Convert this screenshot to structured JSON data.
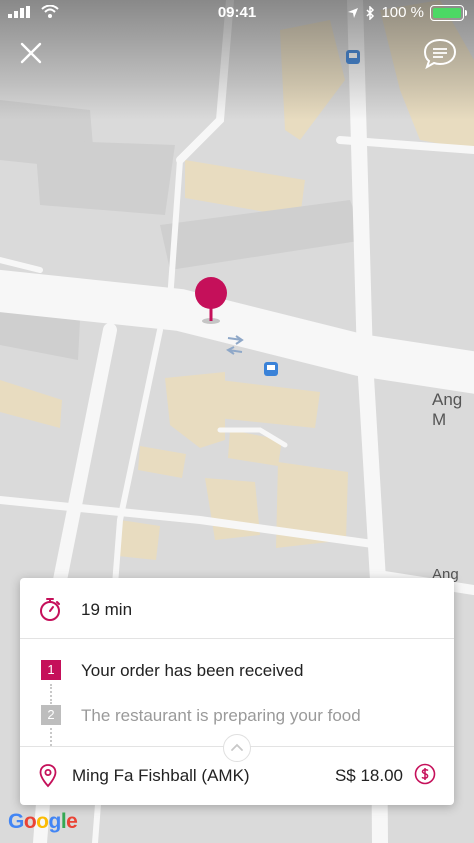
{
  "status_bar": {
    "time": "09:41",
    "battery": "100 %",
    "battery_level": 1.0
  },
  "header": {
    "close_icon": "close-icon",
    "chat_icon": "chat-icon"
  },
  "map": {
    "road_label_1": "Ang M",
    "road_label_2": "Ang M",
    "attribution": "Google",
    "pin_color": "#c5105a"
  },
  "order": {
    "eta": "19 min",
    "steps": [
      {
        "number": "1",
        "label": "Your order has been received",
        "state": "active"
      },
      {
        "number": "2",
        "label": "The restaurant is preparing your food",
        "state": "pending"
      }
    ],
    "restaurant": "Ming Fa Fishball (AMK)",
    "price": "S$ 18.00",
    "accent_color": "#c5105a"
  }
}
